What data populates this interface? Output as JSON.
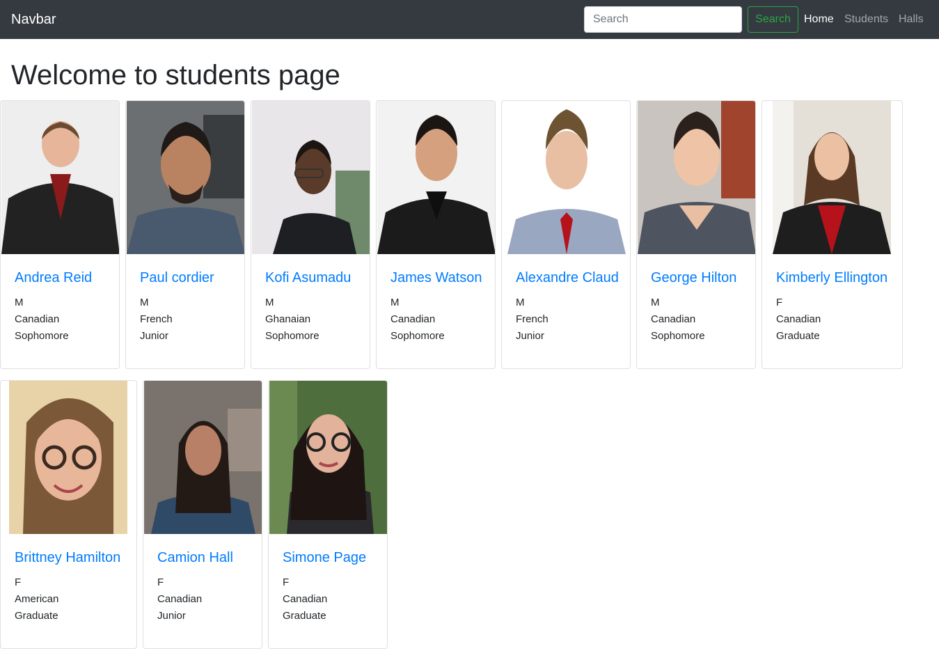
{
  "navbar": {
    "brand": "Navbar",
    "search_placeholder": "Search",
    "search_button": "Search",
    "links": [
      "Home",
      "Students",
      "Halls"
    ]
  },
  "page_title": "Welcome to students page",
  "students": [
    {
      "name": "Andrea Reid",
      "gender": "M",
      "nationality": "Canadian",
      "year": "Sophomore"
    },
    {
      "name": "Paul cordier",
      "gender": "M",
      "nationality": "French",
      "year": "Junior"
    },
    {
      "name": "Kofi Asumadu",
      "gender": "M",
      "nationality": "Ghanaian",
      "year": "Sophomore"
    },
    {
      "name": "James Watson",
      "gender": "M",
      "nationality": "Canadian",
      "year": "Sophomore"
    },
    {
      "name": "Alexandre Claud",
      "gender": "M",
      "nationality": "French",
      "year": "Junior"
    },
    {
      "name": "George Hilton",
      "gender": "M",
      "nationality": "Canadian",
      "year": "Sophomore"
    },
    {
      "name": "Kimberly Ellington",
      "gender": "F",
      "nationality": "Canadian",
      "year": "Graduate"
    },
    {
      "name": "Brittney Hamilton",
      "gender": "F",
      "nationality": "American",
      "year": "Graduate"
    },
    {
      "name": "Camion Hall",
      "gender": "F",
      "nationality": "Canadian",
      "year": "Junior"
    },
    {
      "name": "Simone Page",
      "gender": "F",
      "nationality": "Canadian",
      "year": "Graduate"
    }
  ],
  "colors": {
    "navbar_bg": "#343a40",
    "link_blue": "#007bff",
    "success_green": "#28a745"
  }
}
